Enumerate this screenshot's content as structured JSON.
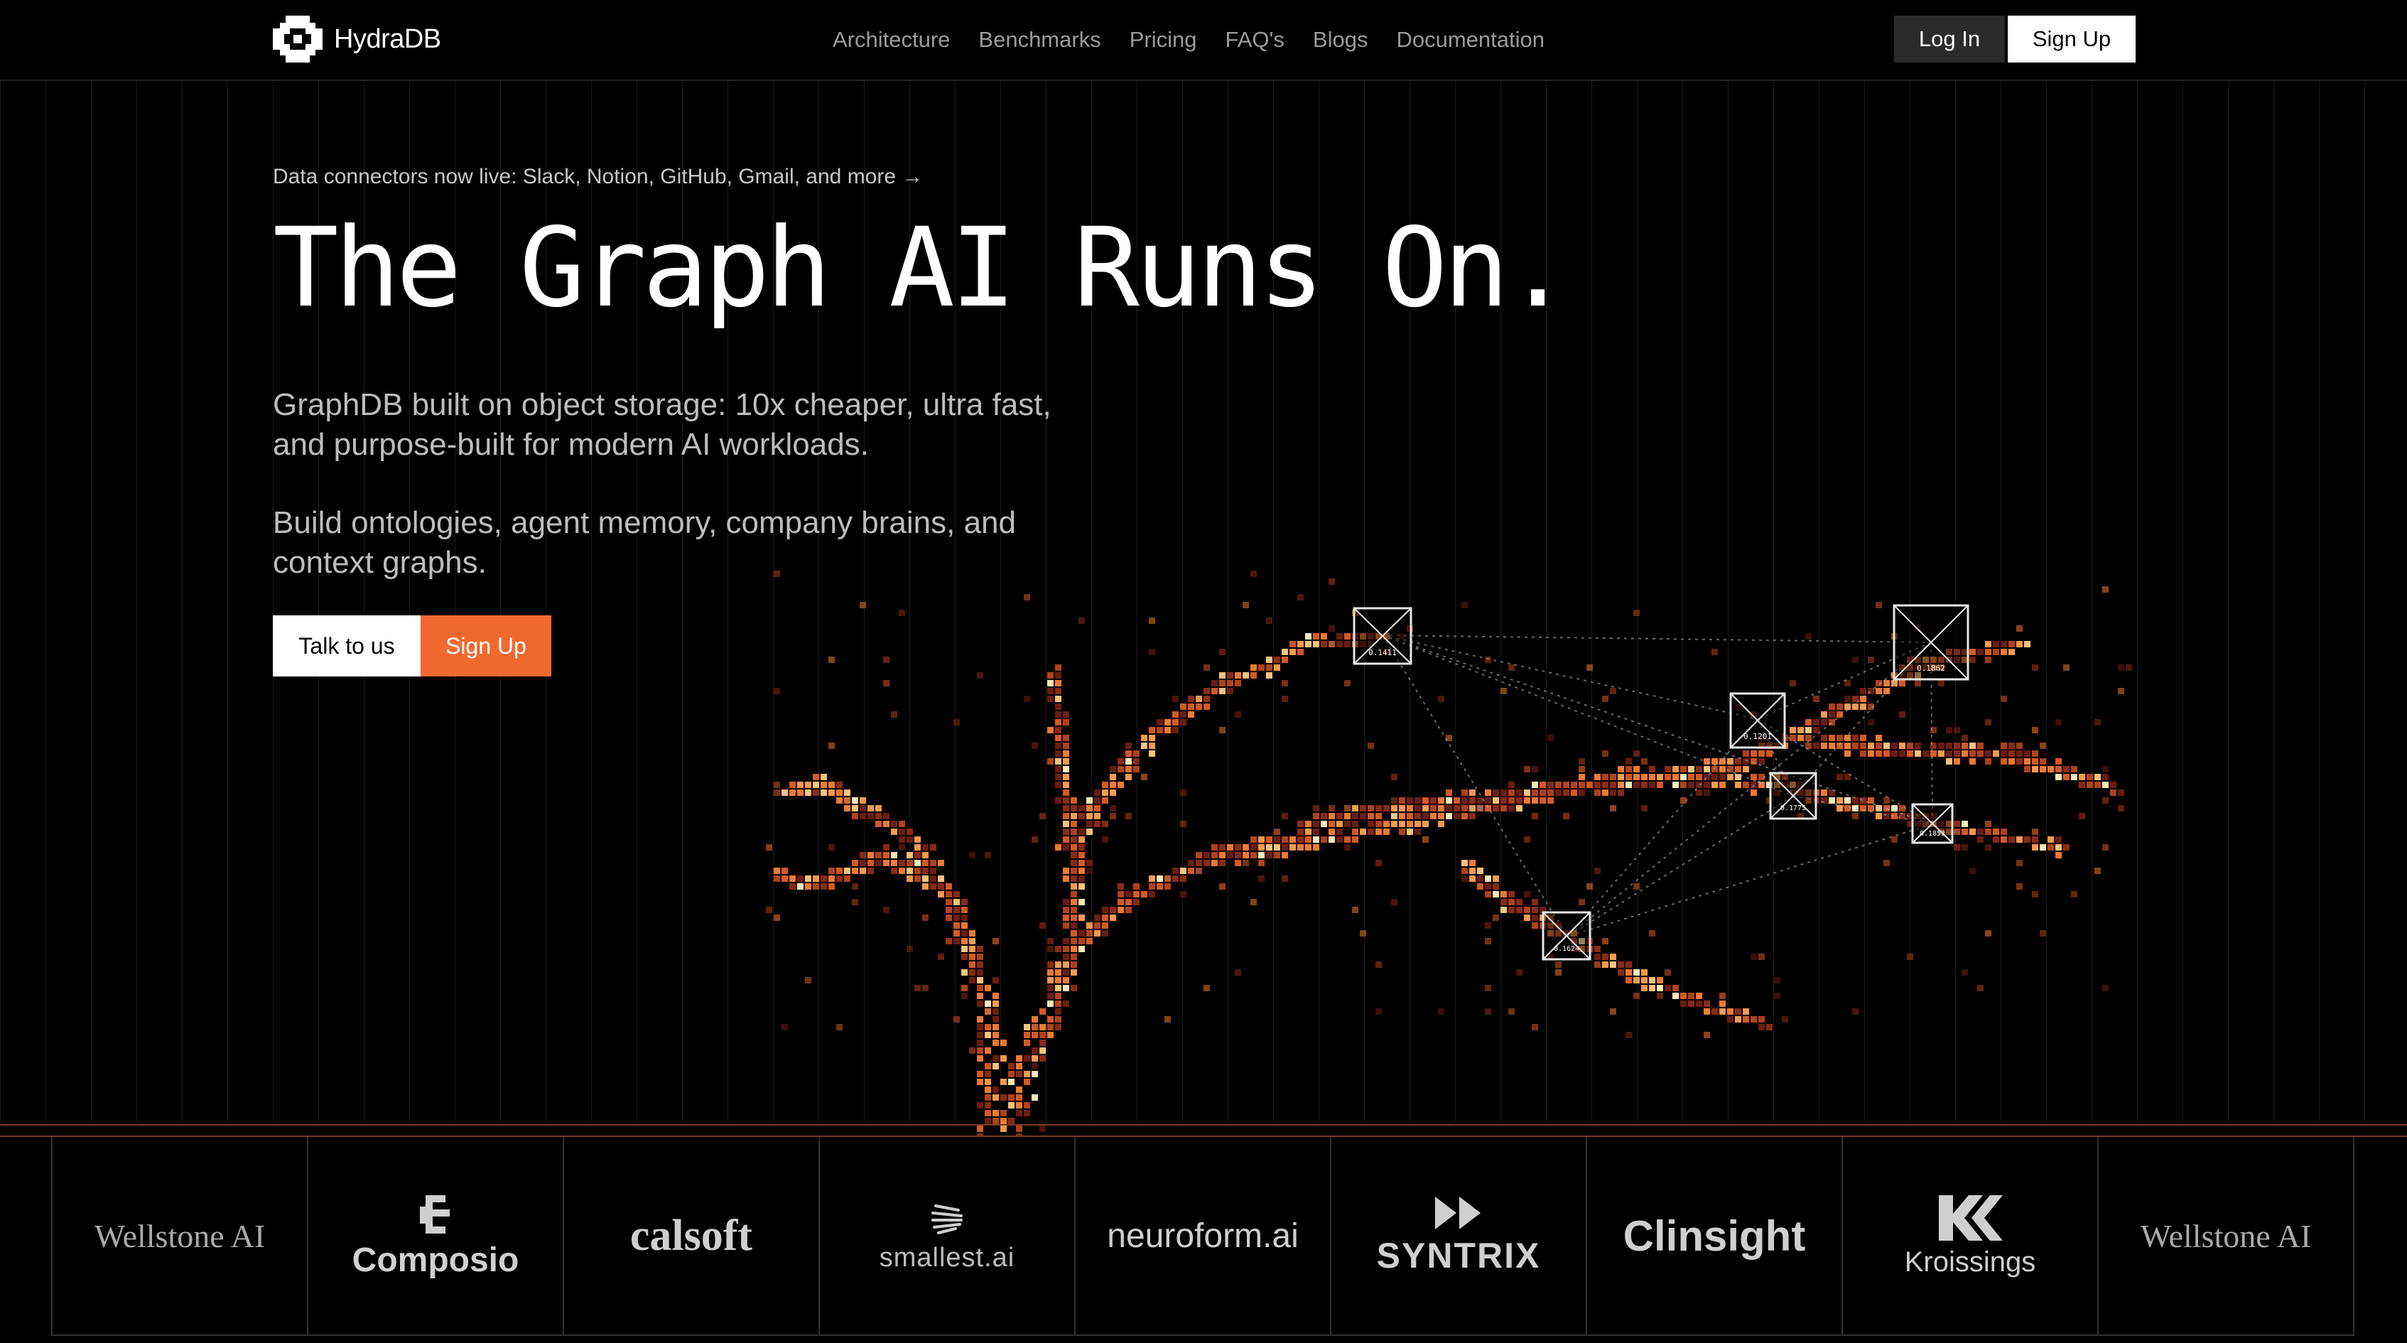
{
  "brand": {
    "name": "HydraDB"
  },
  "nav": {
    "items": [
      "Architecture",
      "Benchmarks",
      "Pricing",
      "FAQ's",
      "Blogs",
      "Documentation"
    ],
    "login": "Log In",
    "signup": "Sign Up"
  },
  "hero": {
    "announcement": "Data connectors now live: Slack, Notion, GitHub, Gmail, and more →",
    "headline": "The Graph AI Runs On.",
    "desc1": "GraphDB built on object storage: 10x cheaper, ultra fast, and purpose-built for modern AI workloads.",
    "desc2": "Build ontologies, agent memory, company brains, and context graphs.",
    "cta_talk": "Talk to us",
    "cta_signup": "Sign Up"
  },
  "graph_nodes": [
    {
      "label": "0.1411"
    },
    {
      "label": "0.1862"
    },
    {
      "label": "0.1201"
    },
    {
      "label": "0.1775"
    },
    {
      "label": "0.1853"
    },
    {
      "label": "0.1624"
    }
  ],
  "customers": [
    "Wellstone AI",
    "Composio",
    "calsoft",
    "smallest.ai",
    "neuroform.ai",
    "SYNTRIX",
    "Clinsight",
    "Kroissings",
    "Wellstone AI"
  ],
  "colors": {
    "accent": "#f06a2f",
    "background": "#000000",
    "nav_muted": "#9b9b9b"
  }
}
